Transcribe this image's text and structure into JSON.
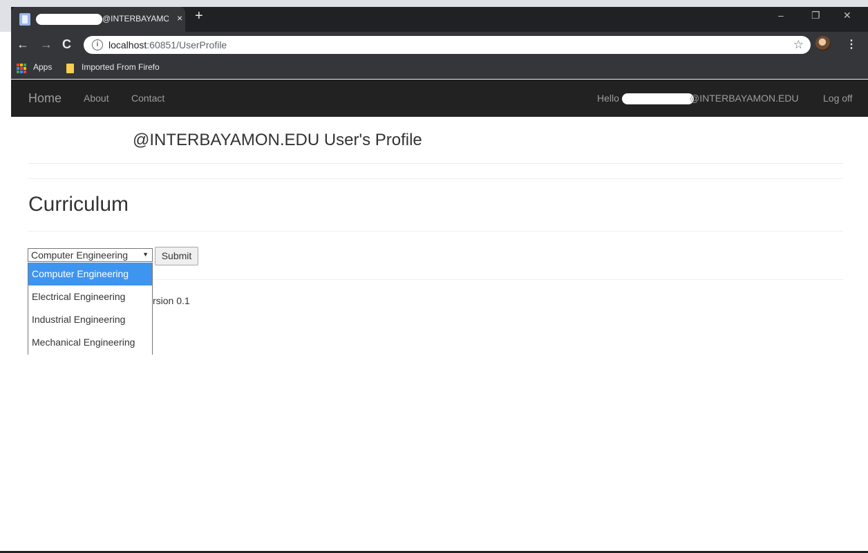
{
  "browser": {
    "tab_title": "@INTERBAYAMON.",
    "tab_close": "×",
    "new_tab": "+",
    "url_host": "localhost",
    "url_rest": ":60851/UserProfile",
    "bookmarks": {
      "apps": "Apps",
      "imported": "Imported From Firefo"
    },
    "window_controls": {
      "minimize": "–",
      "restore": "❐",
      "close": "✕"
    }
  },
  "navbar": {
    "brand": "Home",
    "about": "About",
    "contact": "Contact",
    "hello_prefix": "Hello",
    "hello_suffix": "@INTERBAYAMON.EDU",
    "logoff": "Log off"
  },
  "profile": {
    "title": "@INTERBAYAMON.EDU User's Profile"
  },
  "curriculum": {
    "title": "Curriculum",
    "selected": "Computer Engineering",
    "options": [
      "Computer Engineering",
      "Electrical Engineering",
      "Industrial Engineering",
      "Mechanical Engineering"
    ],
    "submit": "Submit"
  },
  "footer": {
    "version_partial": "rsion 0.1"
  },
  "colors": {
    "navbar_bg": "#222222",
    "selected_option": "#3e95f0"
  }
}
